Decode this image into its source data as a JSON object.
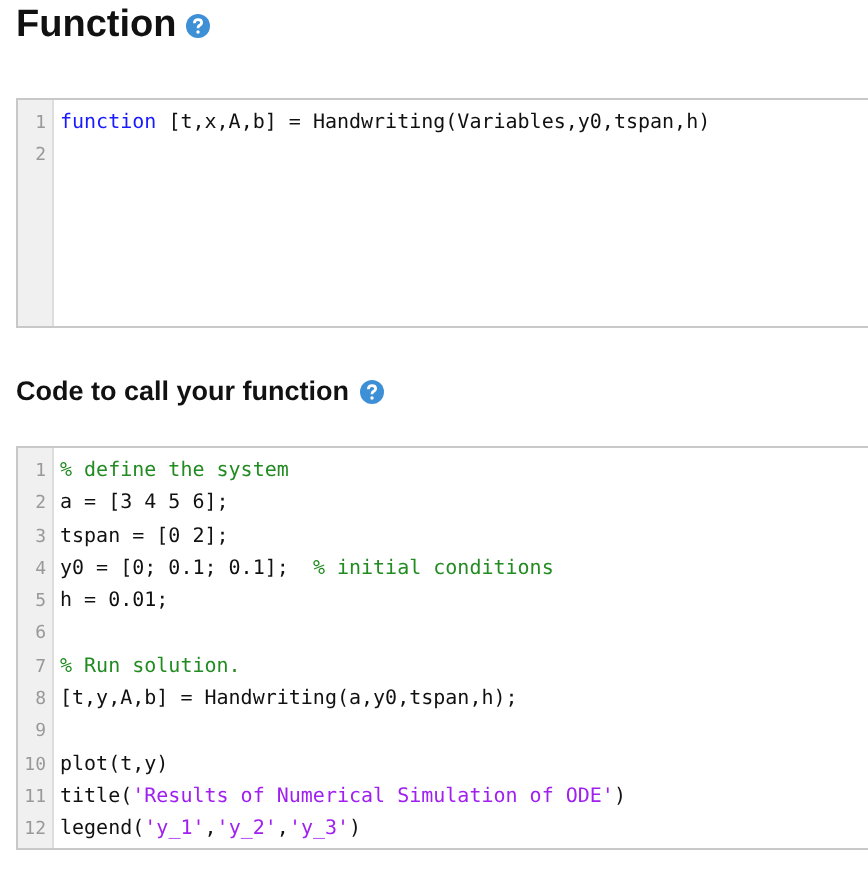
{
  "sections": [
    {
      "heading": "Function",
      "lines": [
        {
          "number": "1",
          "tokens": [
            {
              "kind": "keyword",
              "text": "function"
            },
            {
              "kind": "plain",
              "text": " [t,x,A,b] = Handwriting(Variables,y0,tspan,h)"
            }
          ]
        },
        {
          "number": "2"
        }
      ]
    },
    {
      "heading": "Code to call your function",
      "lines": [
        {
          "number": "1",
          "tokens": [
            {
              "kind": "comment",
              "text": "% define the system"
            }
          ]
        },
        {
          "number": "2",
          "tokens": [
            {
              "kind": "plain",
              "text": "a = [3 4 5 6];"
            }
          ]
        },
        {
          "number": "3",
          "tokens": [
            {
              "kind": "plain",
              "text": "tspan = [0 2];"
            }
          ]
        },
        {
          "number": "4",
          "tokens": [
            {
              "kind": "plain",
              "text": "y0 = [0; 0.1; 0.1];  "
            },
            {
              "kind": "comment",
              "text": "% initial conditions"
            }
          ]
        },
        {
          "number": "5",
          "tokens": [
            {
              "kind": "plain",
              "text": "h = 0.01;"
            }
          ]
        },
        {
          "number": "6"
        },
        {
          "number": "7",
          "tokens": [
            {
              "kind": "comment",
              "text": "% Run solution."
            }
          ]
        },
        {
          "number": "8",
          "tokens": [
            {
              "kind": "plain",
              "text": "[t,y,A,b] = Handwriting(a,y0,tspan,h);"
            }
          ]
        },
        {
          "number": "9"
        },
        {
          "number": "10",
          "tokens": [
            {
              "kind": "plain",
              "text": "plot(t,y)"
            }
          ]
        },
        {
          "number": "11",
          "tokens": [
            {
              "kind": "plain",
              "text": "title("
            },
            {
              "kind": "string",
              "text": "'Results of Numerical Simulation of ODE'"
            },
            {
              "kind": "plain",
              "text": ")"
            }
          ]
        },
        {
          "number": "12",
          "tokens": [
            {
              "kind": "plain",
              "text": "legend("
            },
            {
              "kind": "string",
              "text": "'y_1'"
            },
            {
              "kind": "plain",
              "text": ","
            },
            {
              "kind": "string",
              "text": "'y_2'"
            },
            {
              "kind": "plain",
              "text": ","
            },
            {
              "kind": "string",
              "text": "'y_3'"
            },
            {
              "kind": "plain",
              "text": ")"
            }
          ]
        }
      ]
    }
  ]
}
